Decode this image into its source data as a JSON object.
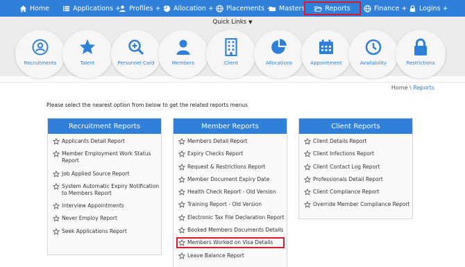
{
  "nav": {
    "items": [
      {
        "label": "Home",
        "icon": "home-icon"
      },
      {
        "label": "Applications +",
        "icon": "list-icon"
      },
      {
        "label": "Profiles +",
        "icon": "user-icon"
      },
      {
        "label": "Allocation +",
        "icon": "pie-icon"
      },
      {
        "label": "Placements +",
        "icon": "globe-icon"
      },
      {
        "label": "Masters",
        "icon": "folder-icon"
      },
      {
        "label": "Reports",
        "icon": "folder-open-icon",
        "active": true
      },
      {
        "label": "Finance +",
        "icon": "globe-icon"
      },
      {
        "label": "Logins +",
        "icon": "lock-icon"
      }
    ]
  },
  "quick_links": {
    "title": "Quick Links",
    "items": [
      {
        "label": "Recruitments",
        "icon": "recruitment-icon"
      },
      {
        "label": "Talent",
        "icon": "star-icon"
      },
      {
        "label": "Personnel Card",
        "icon": "search-plus-icon"
      },
      {
        "label": "Members",
        "icon": "user-icon"
      },
      {
        "label": "Client",
        "icon": "building-icon"
      },
      {
        "label": "Allocations",
        "icon": "pie-icon"
      },
      {
        "label": "Appointment",
        "icon": "calendar-icon"
      },
      {
        "label": "Availability",
        "icon": "clock-icon"
      },
      {
        "label": "Restrictions",
        "icon": "lock-icon"
      }
    ]
  },
  "breadcrumb": {
    "home": "Home",
    "sep": " \\ ",
    "current": "Reports"
  },
  "instruction": "Please select the nearest option from below to get the related reports menus",
  "panels": [
    {
      "title": "Recruitment Reports",
      "items": [
        "Applicants Detail Report",
        "Member Employment Work Status Report",
        "Job Applied Source Report",
        "System Automatic Expiry Notification to Members Report",
        "Interview Appointments",
        "Never Employ Report",
        "Seek Applications Report"
      ]
    },
    {
      "title": "Member Reports",
      "items": [
        "Members Detail Report",
        "Expiry Checks Report",
        "Request & Restrictions Report",
        "Member Document Expiry Date",
        "Health Check Report - Old Version",
        "Training Report - Old Version",
        "Electronic Tax File Declaration Report",
        "Booked Members Documents Details",
        "Members Worked on Visa Details",
        "Leave Balance Report"
      ],
      "highlighted_index": 8
    },
    {
      "title": "Client Reports",
      "items": [
        "Client Details Report",
        "Client Infections Report",
        "Client Contact Log Report",
        "Professionals Detail Report",
        "Client Compliance Report",
        "Override Member Compliance Report"
      ]
    }
  ],
  "colors": {
    "accent": "#2f80d8",
    "highlight": "#e0162b",
    "band": "#ececec"
  }
}
